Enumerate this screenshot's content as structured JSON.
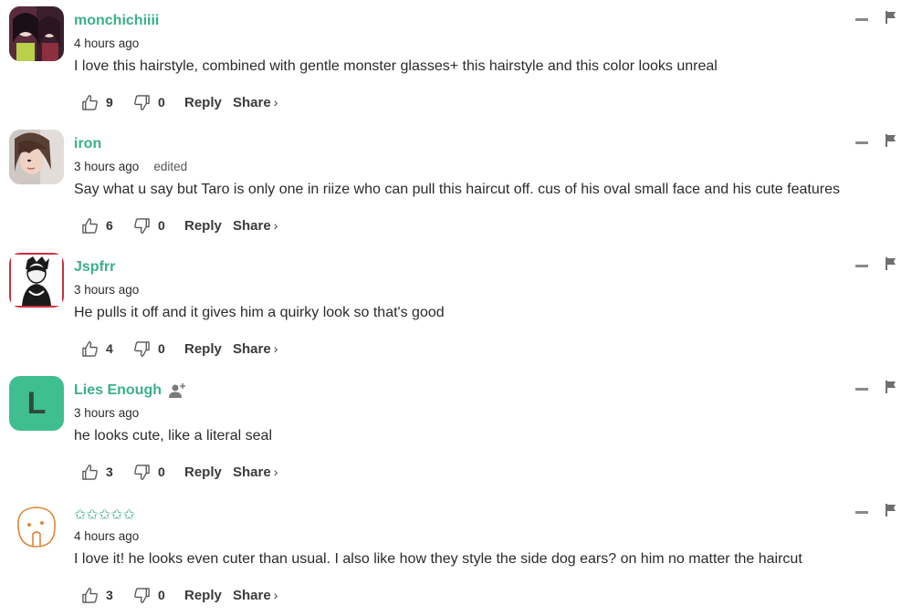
{
  "comments": [
    {
      "username": "monchichiiii",
      "time": "4 hours ago",
      "edited": "",
      "text": "I love this hairstyle, combined with gentle monster glasses+ this hairstyle and this color looks unreal",
      "likes": "9",
      "dislikes": "0",
      "reply_label": "Reply",
      "share_label": "Share",
      "share_chevron": "›"
    },
    {
      "username": "iron",
      "time": "3 hours ago",
      "edited": "edited",
      "text": "Say what u say but Taro is only one in riize who can pull this haircut off. cus of his oval small face and his cute features",
      "likes": "6",
      "dislikes": "0",
      "reply_label": "Reply",
      "share_label": "Share",
      "share_chevron": "›"
    },
    {
      "username": "Jspfrr",
      "time": "3 hours ago",
      "edited": "",
      "text": "He pulls it off and it gives him a quirky look so that's good",
      "likes": "4",
      "dislikes": "0",
      "reply_label": "Reply",
      "share_label": "Share",
      "share_chevron": "›"
    },
    {
      "username": "Lies Enough",
      "avatar_letter": "L",
      "time": "3 hours ago",
      "edited": "",
      "text": "he looks cute, like a literal seal",
      "likes": "3",
      "dislikes": "0",
      "reply_label": "Reply",
      "share_label": "Share",
      "share_chevron": "›"
    },
    {
      "username": "✩✩✩✩✩",
      "time": "4 hours ago",
      "edited": "",
      "text": "I love it! he looks even cuter than usual. I also like how they style the side dog ears? on him no matter the haircut",
      "likes": "3",
      "dislikes": "0",
      "reply_label": "Reply",
      "share_label": "Share",
      "share_chevron": "›"
    }
  ],
  "colors": {
    "username": "#3ab08a",
    "avatar_letter_bg": "#3fbf8f",
    "text": "#2b2b2b",
    "icon_gray": "#8a8a8a"
  },
  "icons": {
    "like": "thumbs-up-icon",
    "dislike": "thumbs-down-icon",
    "collapse": "minus-icon",
    "report": "flag-icon",
    "follow": "add-person-icon"
  }
}
